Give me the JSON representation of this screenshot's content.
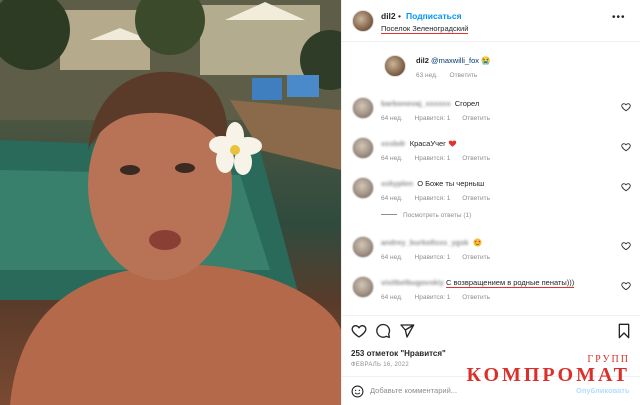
{
  "post": {
    "author": "dil2",
    "follow_label": "Подписаться",
    "location": "Поселок Зеленоградский",
    "likes": "253 отметок \"Нравится\"",
    "date": "ФЕВРАЛЬ 16, 2022",
    "add_comment_placeholder": "Добавьте комментарий...",
    "publish_label": "Опубликовать"
  },
  "comments": [
    {
      "user": "dil2",
      "text": "@maxwilli_fox 😭",
      "age": "63 нед.",
      "likes": "",
      "reply": "Ответить"
    },
    {
      "user": "barbonovaj_xxxxxx",
      "text": "Сгорел",
      "age": "64 нед.",
      "likes": "Нравится: 1",
      "reply": "Ответить"
    },
    {
      "user": "xxxbdr",
      "text": "КрасаУчег",
      "age": "64 нед.",
      "likes": "Нравится: 1",
      "reply": "Ответить"
    },
    {
      "user": "xxkyplen",
      "text": "О Боже ты черныш",
      "age": "64 нед.",
      "likes": "Нравится: 1",
      "reply": "Ответить"
    },
    {
      "user": "andrey_burkollxxx_ygsk",
      "text": "",
      "age": "64 нед.",
      "likes": "Нравится: 1",
      "reply": "Ответить"
    },
    {
      "user": "visitbelbugovskiy",
      "text": "С возвращением в родные пенаты)))",
      "age": "64 нед.",
      "likes": "Нравится: 1",
      "reply": "Ответить"
    }
  ],
  "view_replies": "Посмотреть ответы (1)",
  "icons": {
    "heart": "heart-icon",
    "comment": "comment-icon",
    "share": "share-icon",
    "save": "bookmark-icon",
    "more": "more-icon",
    "emoji": "emoji-icon"
  },
  "colors": {
    "accent": "#0095f6",
    "highlight": "#e0342e",
    "muted": "#8e8e8e"
  },
  "watermark": {
    "main": "КОМПРОМАТ",
    "sub": "ГРУПП"
  }
}
